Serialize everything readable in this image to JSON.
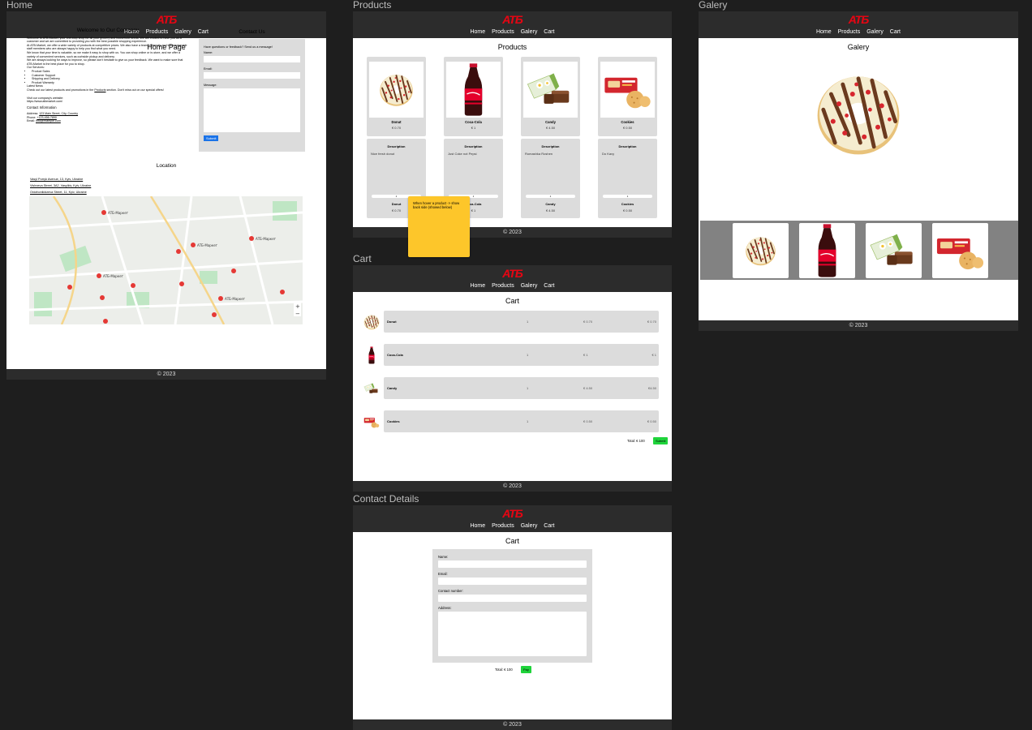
{
  "brand": {
    "logo": "ATБ"
  },
  "frames": {
    "home": "Home",
    "products": "Products",
    "galery": "Galery",
    "cart": "Cart",
    "contact": "Contact Details"
  },
  "nav": [
    "Home",
    "Products",
    "Galery",
    "Cart"
  ],
  "footer": "© 2023",
  "home": {
    "title": "Home Page",
    "welcome_title": "Welcome to Our Company",
    "p1": "Welcome to ATB-Market, your one-stop shop for all your grocery and household needs. We are excited to have you as a customer and we are committed to providing you with the best possible shopping experience.",
    "p2": "At ATB-Market, we offer a wide variety of products at competitive prices. We also have a team of friendly and knowledgeable staff members who are always happy to help you find what you need.",
    "p3": "We know that your time is valuable, so we make it easy to shop with us. You can shop online or in-store, and we offer a variety of convenient services, such as curbside pickup and delivery.",
    "p4": "We are always looking for ways to improve, so please don't hesitate to give us your feedback. We want to make sure that ATB-Market is the best place for you to shop.",
    "services_label": "Our Services:",
    "services": [
      "Product Sales",
      "Customer Support",
      "Shipping and Delivery",
      "Product Warranty"
    ],
    "news_label": "Latest News",
    "news_pre": "Check out our latest products and promotions in the",
    "news_link": "Products",
    "news_post": "section. Don't miss out on our special offers!",
    "website_label": "Visit our company's website:",
    "website": "https://www.atbmarket.com/",
    "contact_info_label": "Contact Information",
    "address_label": "Address:",
    "address": "123 Main Street, City, Country",
    "phone_label": "Phone:",
    "phone": "+123-456-7890",
    "email_label": "Email:",
    "email": "info@example.com",
    "contact_title": "Contact Us",
    "contact_prompt": "Have questions or feedback? Send us a message!",
    "name_label": "Name:",
    "email_field_label": "Email:",
    "message_label": "Message:",
    "submit": "Submit",
    "location_title": "Location",
    "locations": [
      "Vasyl Porryk Avenue, 13, Kyiv, Ukraine",
      "Vishneva Street, 3А2, Vasylkiv, Kyiv, Ukraine",
      "Ordzhonikidzeva Street, 11, Kyiv, Ukraine"
    ],
    "map_marker": "АТБ-Маркет"
  },
  "products": {
    "title": "Products",
    "items": [
      {
        "name": "Donut",
        "price": "€ 0.70",
        "desc": "Nice fresh donut"
      },
      {
        "name": "Coca-Cola",
        "price": "€ 1",
        "desc": "Just Coke not Pepsi"
      },
      {
        "name": "Candy",
        "price": "€ 4.50",
        "desc": "Romashka Roshen"
      },
      {
        "name": "Cookies",
        "price": "€ 0.50",
        "desc": "Do Kavy"
      }
    ],
    "desc_heading": "Description",
    "qty": "1",
    "note": "When hover a product -> show back side (showed below)"
  },
  "cart": {
    "title": "Cart",
    "rows": [
      {
        "name": "Donut",
        "qty": "1",
        "price": "€ 0.70",
        "total": "€ 0.70"
      },
      {
        "name": "Coca-Cola",
        "qty": "1",
        "price": "€ 1",
        "total": "€ 1"
      },
      {
        "name": "Candy",
        "qty": "1",
        "price": "€ 4.50",
        "total": "€4.50"
      },
      {
        "name": "Cookies",
        "qty": "1",
        "price": "€ 0.50",
        "total": "€ 0.50"
      }
    ],
    "total": "Total:  € 100",
    "submit": "Submit"
  },
  "contact": {
    "title": "Cart",
    "name_label": "Name:",
    "email_label": "Email:",
    "number_label": "Contact number:",
    "address_label": "Address:",
    "total": "Total:  € 100",
    "pay": "Pay"
  },
  "galery": {
    "title": "Galery"
  },
  "colors": {
    "header": "#2c2c2c",
    "logo": "#e20613",
    "card": "#dcdcdc",
    "note": "#fdc62a",
    "green": "#1fd43b",
    "blue": "#1a73e8"
  }
}
